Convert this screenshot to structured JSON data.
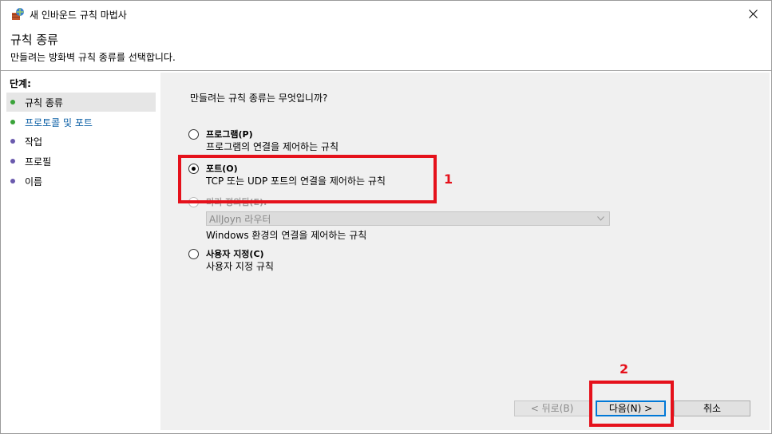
{
  "window": {
    "title": "새 인바운드 규칙 마법사"
  },
  "header": {
    "title": "규칙 종류",
    "description": "만들려는 방화벽 규칙 종류를 선택합니다."
  },
  "steps": {
    "title": "단계:",
    "items": [
      {
        "label": "규칙 종류",
        "status": "complete"
      },
      {
        "label": "프로토콜 및 포트",
        "status": "current"
      },
      {
        "label": "작업",
        "status": "pending"
      },
      {
        "label": "프로필",
        "status": "pending"
      },
      {
        "label": "이름",
        "status": "pending"
      }
    ]
  },
  "content": {
    "question": "만들려는 규칙 종류는 무엇입니까?",
    "options": [
      {
        "label": "프로그램(P)",
        "description": "프로그램의 연결을 제어하는 규칙",
        "selected": false
      },
      {
        "label": "포트(O)",
        "description": "TCP 또는 UDP 포트의 연결을 제어하는 규칙",
        "selected": true
      },
      {
        "label": "미리 정의됨(E):",
        "description": "Windows 환경의 연결을 제어하는 규칙",
        "selected": false,
        "dropdown_value": "AllJoyn 라우터"
      },
      {
        "label": "사용자 지정(C)",
        "description": "사용자 지정 규칙",
        "selected": false
      }
    ]
  },
  "buttons": {
    "back": "< 뒤로(B)",
    "next": "다음(N) >",
    "cancel": "취소"
  },
  "annotations": {
    "one": "1",
    "two": "2",
    "color": "#e5111b"
  }
}
